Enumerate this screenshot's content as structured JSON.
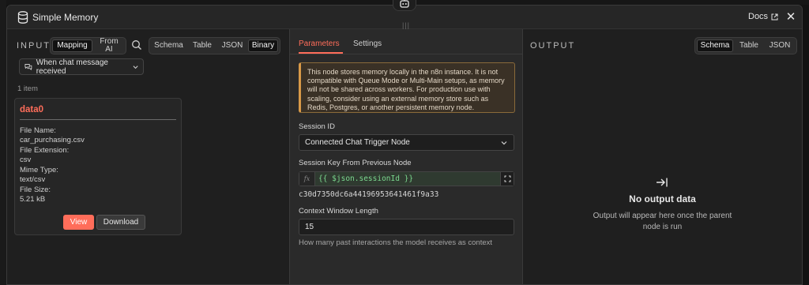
{
  "header": {
    "title": "Simple Memory",
    "docs_label": "Docs",
    "close_label": "✕"
  },
  "input_panel": {
    "label": "INPUT",
    "mode_tabs": [
      "Mapping",
      "From AI"
    ],
    "view_tabs": [
      "Schema",
      "Table",
      "JSON",
      "Binary"
    ],
    "active_view": "Binary",
    "node_selector": "When chat message received",
    "item_count": "1 item",
    "binary": {
      "name": "data0",
      "fields": [
        {
          "label": "File Name:",
          "value": "car_purchasing.csv"
        },
        {
          "label": "File Extension:",
          "value": "csv"
        },
        {
          "label": "Mime Type:",
          "value": "text/csv"
        },
        {
          "label": "File Size:",
          "value": "5.21 kB"
        }
      ],
      "view_label": "View",
      "download_label": "Download"
    }
  },
  "params_panel": {
    "tabs": [
      "Parameters",
      "Settings"
    ],
    "active_tab": "Parameters",
    "notice": "This node stores memory locally in the n8n instance. It is not compatible with Queue Mode or Multi-Main setups, as memory will not be shared across workers. For production use with scaling, consider using an external memory store such as Redis, Postgres, or another persistent memory node.",
    "session_id_label": "Session ID",
    "session_id_value": "Connected Chat Trigger Node",
    "session_key_label": "Session Key From Previous Node",
    "session_key_fx": "fx",
    "session_key_expression": "{{ $json.sessionId }}",
    "session_key_result": "c30d7350dc6a44196953641461f9a33",
    "context_window_label": "Context Window Length",
    "context_window_value": "15",
    "context_window_hint": "How many past interactions the model receives as context"
  },
  "output_panel": {
    "label": "OUTPUT",
    "view_tabs": [
      "Schema",
      "Table",
      "JSON"
    ],
    "active_view": "Schema",
    "empty_title": "No output data",
    "empty_message": "Output will appear here once the parent node is run"
  },
  "colors": {
    "accent": "#ff6d5a",
    "warning_border": "#d99a48",
    "expression_text": "#7bd88f"
  }
}
